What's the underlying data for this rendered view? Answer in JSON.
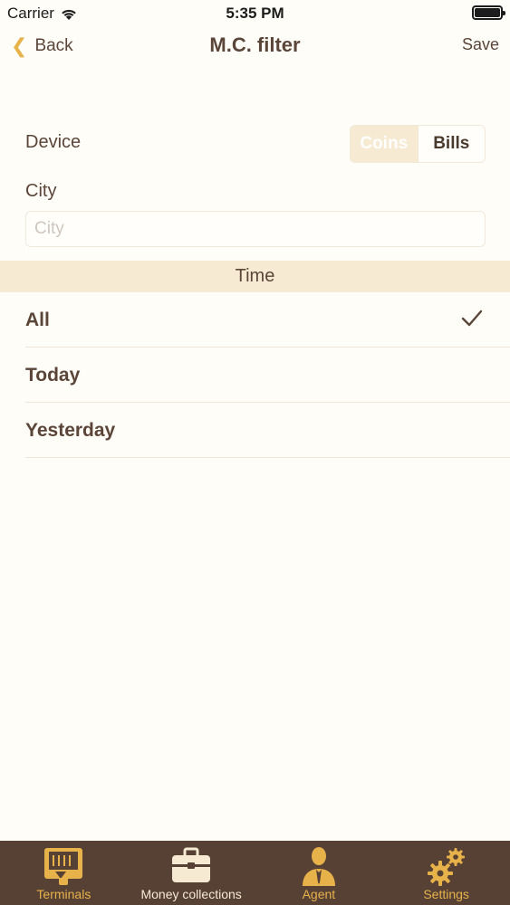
{
  "status_bar": {
    "carrier": "Carrier",
    "time": "5:35 PM"
  },
  "nav": {
    "back_label": "Back",
    "title": "M.C. filter",
    "save_label": "Save"
  },
  "device": {
    "label": "Device",
    "options": [
      "Coins",
      "Bills"
    ],
    "selected": "Coins"
  },
  "city": {
    "label": "City",
    "placeholder": "City",
    "value": ""
  },
  "time": {
    "header": "Time",
    "options": [
      {
        "label": "All",
        "checked": true
      },
      {
        "label": "Today",
        "checked": false
      },
      {
        "label": "Yesterday",
        "checked": false
      }
    ]
  },
  "tabs": [
    {
      "label": "Terminals",
      "icon": "atm-terminal-icon",
      "active": true
    },
    {
      "label": "Money collections",
      "icon": "briefcase-icon",
      "active": false
    },
    {
      "label": "Agent",
      "icon": "agent-person-icon",
      "active": false
    },
    {
      "label": "Settings",
      "icon": "gears-icon",
      "active": false
    }
  ],
  "colors": {
    "accent": "#e8b24a",
    "text": "#5a4538",
    "section_background": "#f6ead2",
    "tab_bar_background": "#574034"
  }
}
